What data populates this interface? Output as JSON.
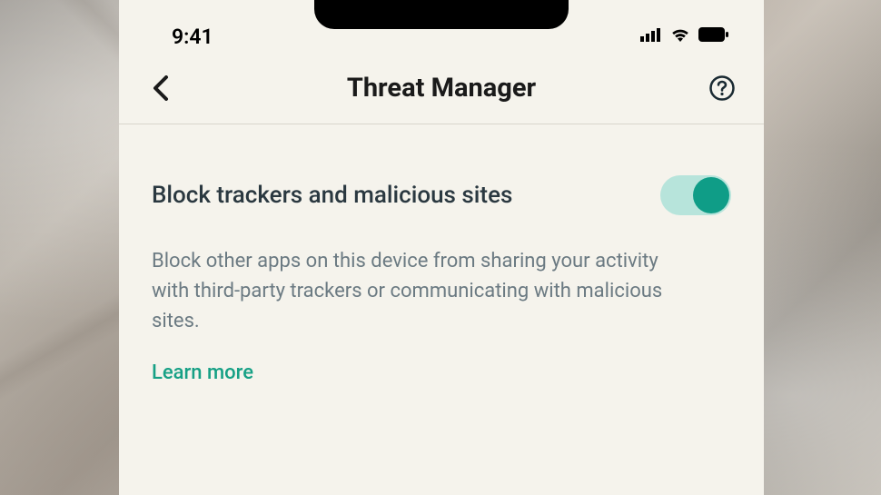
{
  "statusBar": {
    "time": "9:41"
  },
  "nav": {
    "title": "Threat Manager"
  },
  "setting": {
    "title": "Block trackers and malicious sites",
    "description": "Block other apps on this device from sharing your activity with third-party trackers or communicating with malicious sites.",
    "learnMore": "Learn more",
    "enabled": true
  }
}
